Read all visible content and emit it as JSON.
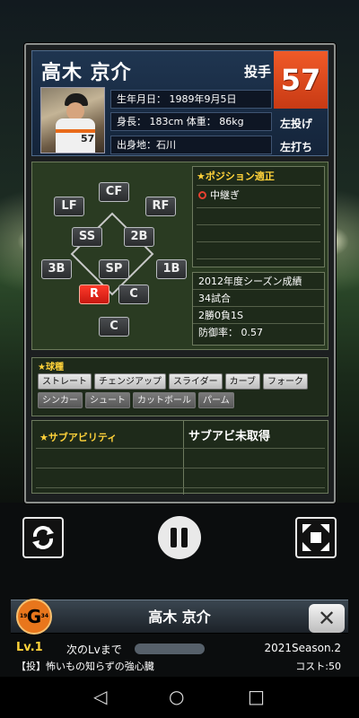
{
  "player": {
    "name": "高木 京介",
    "position": "投手",
    "number": "57",
    "birthdate": "生年月日： 1989年9月5日",
    "body": "身長： 183cm 体重： 86kg",
    "birthplace": "出身地：石川",
    "throws": "左投げ",
    "bats": "左打ち",
    "photo_number": "57"
  },
  "field_positions": [
    {
      "label": "CF",
      "active": false
    },
    {
      "label": "LF",
      "active": false
    },
    {
      "label": "RF",
      "active": false
    },
    {
      "label": "SS",
      "active": false
    },
    {
      "label": "2B",
      "active": false
    },
    {
      "label": "3B",
      "active": false
    },
    {
      "label": "SP",
      "active": false
    },
    {
      "label": "1B",
      "active": false
    },
    {
      "label": "R",
      "active": true
    },
    {
      "label": "C",
      "active": false
    },
    {
      "label": "C",
      "active": false
    }
  ],
  "aptitude": {
    "title": "★ポジション適正",
    "items": [
      "中継ぎ"
    ]
  },
  "season": {
    "title": "2012年度シーズン成績",
    "games": "34試合",
    "record": "2勝0負1S",
    "era": "防御率： 0.57"
  },
  "pitches": {
    "title": "★球種",
    "items": [
      {
        "label": "ストレート",
        "dim": false
      },
      {
        "label": "チェンジアップ",
        "dim": false
      },
      {
        "label": "スライダー",
        "dim": false
      },
      {
        "label": "カーブ",
        "dim": false
      },
      {
        "label": "フォーク",
        "dim": false
      },
      {
        "label": "シンカー",
        "dim": true
      },
      {
        "label": "シュート",
        "dim": true
      },
      {
        "label": "カットボール",
        "dim": true
      },
      {
        "label": "パーム",
        "dim": true
      }
    ]
  },
  "sub_ability": {
    "title": "★サブアビリティ",
    "status": "サブアビ未取得"
  },
  "bottom": {
    "team_logo": "G",
    "team_small_left": "19",
    "team_small_right": "34",
    "name": "高木 京介",
    "close": "✕",
    "level": "Lv.1",
    "next_level": "次のLvまで",
    "season_tag": "2021Season.2",
    "skill": "【投】怖いもの知らずの強心臓",
    "cost": "コスト:50"
  },
  "icons": {
    "refresh": "refresh-icon",
    "pause": "pause-icon",
    "expand": "expand-icon"
  },
  "nav": {
    "back": "◁",
    "home": "○",
    "recent": "□"
  }
}
